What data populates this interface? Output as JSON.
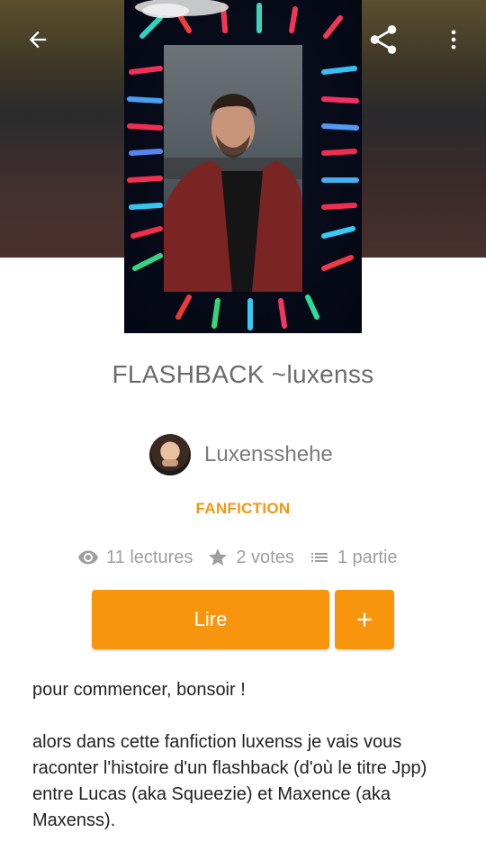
{
  "header": {
    "back_icon": "arrow-left-icon",
    "share_icon": "share-icon",
    "more_icon": "more-vert-icon"
  },
  "story": {
    "title": "FLASHBACK ~luxenss",
    "author": "Luxensshehe",
    "category": "FANFICTION",
    "stats": {
      "reads": "11 lectures",
      "votes": "2 votes",
      "parts": "1 partie"
    },
    "read_button": "Lire",
    "add_button": "+",
    "description": [
      "pour commencer, bonsoir !",
      "alors dans cette fanfiction luxenss je vais vous raconter l'histoire d'un flashback (d'où le titre Jpp) entre Lucas (aka Squeezie) et Maxence (aka Maxenss)."
    ]
  },
  "colors": {
    "accent": "#f7950c",
    "category": "#f5960f",
    "muted": "#9e9e9e"
  }
}
